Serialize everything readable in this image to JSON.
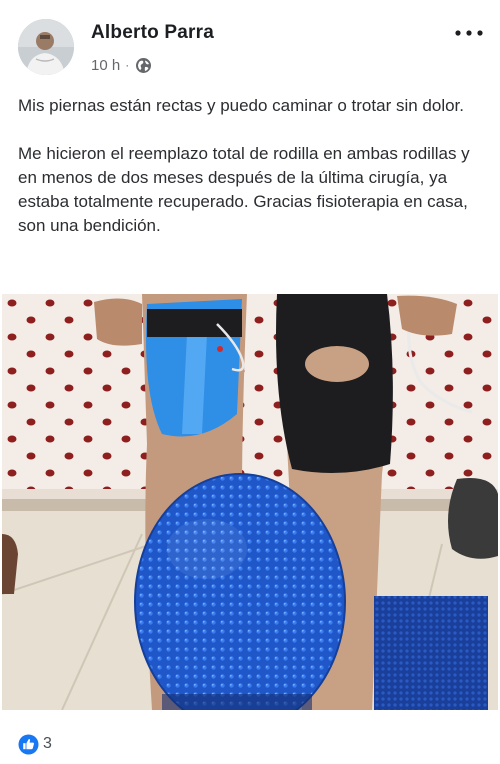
{
  "post": {
    "author": "Alberto Parra",
    "timestamp": "10 h",
    "separator": "·",
    "privacy_icon": "globe-icon",
    "more_icon": "more-options-icon",
    "paragraphs": [
      "Mis piernas están rectas y puedo caminar o trotar sin dolor.",
      "Me hicieron el reemplazo total de rodilla en ambas rodillas y en menos de dos meses después de la última cirugía, ya estaba totalmente recuperado. Gracias fisioterapia en casa, son una bendición."
    ]
  },
  "reactions": {
    "icon": "like-icon",
    "count": "3"
  },
  "colors": {
    "like_blue": "#1877f2",
    "kinesio_tape": "#2f8ee6",
    "knee_brace": "#1d1d1f",
    "balance_ball": "#1f57c9",
    "sofa_pattern": "#8e1f1f"
  }
}
